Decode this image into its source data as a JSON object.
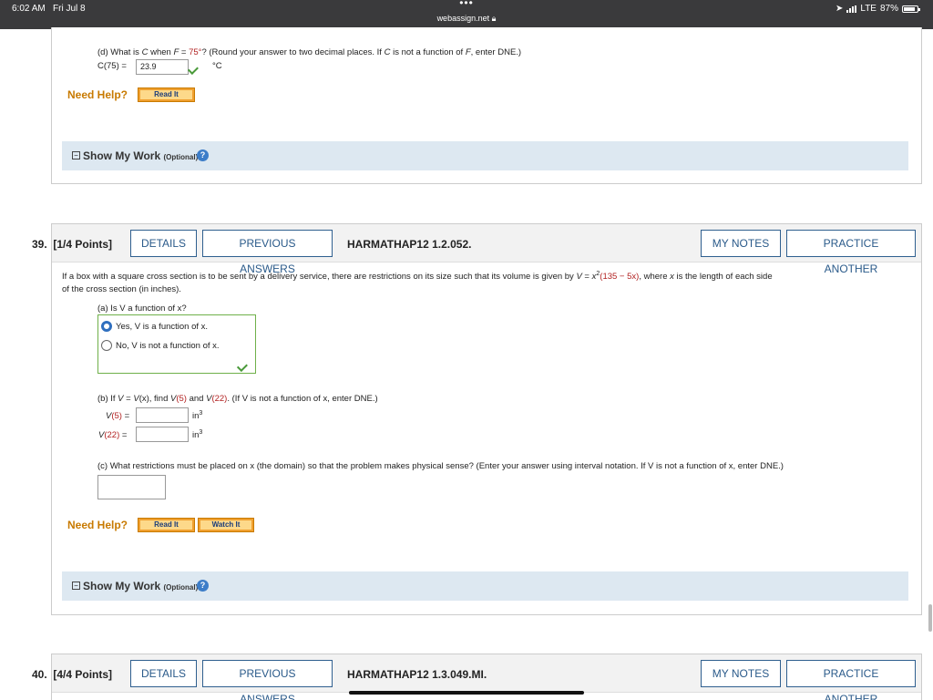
{
  "status": {
    "time": "6:02 AM",
    "date": "Fri Jul 8",
    "dots": "•••",
    "url": "webassign.net",
    "network": "LTE",
    "battery": "87%",
    "battery_level": 0.87
  },
  "q38": {
    "part_d_prompt_a": "(d) What is ",
    "part_d_var_c": "C",
    "part_d_prompt_b": " when ",
    "part_d_var_f": "F",
    "part_d_eq": " = ",
    "part_d_value": "75°",
    "part_d_prompt_c": "? (Round your answer to two decimal places. If ",
    "part_d_var_c2": "C",
    "part_d_prompt_d": " is not a function of ",
    "part_d_var_f2": "F",
    "part_d_prompt_e": ", enter DNE.)",
    "answer_label": "C(75) =",
    "answer_value": "23.9",
    "answer_unit": "°C",
    "need_help": "Need Help?",
    "read_it": "Read It",
    "show_my_work": "Show My Work",
    "optional": "(Optional)"
  },
  "q39": {
    "number": "39.",
    "points": "[1/4 Points]",
    "details": "DETAILS",
    "previous_answers": "PREVIOUS ANSWERS",
    "code": "HARMATHAP12 1.2.052.",
    "my_notes": "MY NOTES",
    "practice_another": "PRACTICE ANOTHER",
    "stem_line1_a": "If a box with a square cross section is to be sent by a delivery service, there are restrictions on its size such that its volume is given by ",
    "stem_v": "V",
    "stem_eq": " = ",
    "stem_x2": "x",
    "stem_sup": "2",
    "stem_paren": "(135 − 5x)",
    "stem_line1_b": ", where ",
    "stem_x": "x",
    "stem_line1_c": " is the length of each side",
    "stem_line2": "of the cross section (in inches).",
    "part_a": "(a) Is V a function of x?",
    "option_yes": "Yes, V is a function of x.",
    "option_no": "No, V is not a function of x.",
    "selected_option": "yes",
    "part_b_a": "(b) If ",
    "part_b_b": "V",
    "part_b_c": " = ",
    "part_b_d": "V",
    "part_b_e": "(x), find ",
    "part_b_f": "V",
    "part_b_g": "(5)",
    "part_b_h": " and ",
    "part_b_i": "V",
    "part_b_j": "(22)",
    "part_b_k": ". (If V is not a function of x, enter DNE.)",
    "v5_label_a": "V",
    "v5_label_b": "(5)",
    "v5_label_c": " =",
    "v22_label_a": "V",
    "v22_label_b": "(22)",
    "v22_label_c": " =",
    "v5_value": "",
    "v22_value": "",
    "unit": "in",
    "unit_sup": "3",
    "part_c": "(c) What restrictions must be placed on x (the domain) so that the problem makes physical sense? (Enter your answer using interval notation. If V is not a function of x, enter DNE.)",
    "domain_value": "",
    "need_help": "Need Help?",
    "read_it": "Read It",
    "watch_it": "Watch It",
    "show_my_work": "Show My Work",
    "optional": "(Optional)"
  },
  "q40": {
    "number": "40.",
    "points": "[4/4 Points]",
    "details": "DETAILS",
    "previous_answers": "PREVIOUS ANSWERS",
    "code": "HARMATHAP12 1.3.049.MI.",
    "my_notes": "MY NOTES",
    "practice_another": "PRACTICE ANOTHER"
  },
  "colors": {
    "status_bar": "#3a3a3c",
    "accent_blue": "#2a5a8a",
    "help_orange": "#c87a00",
    "correct_green": "#4a9a3a",
    "highlight_red": "#b22222",
    "work_panel": "#dde8f1"
  }
}
